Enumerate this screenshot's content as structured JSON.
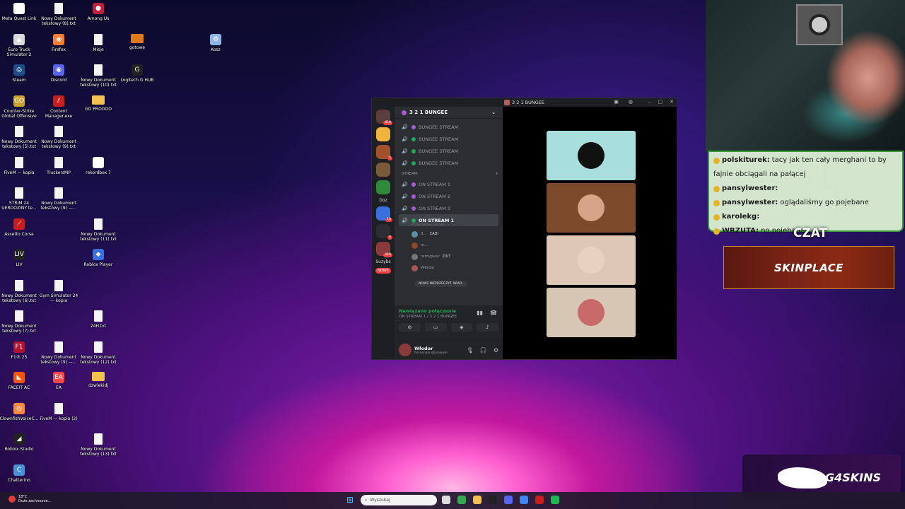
{
  "desktop": {
    "icons": [
      {
        "label": "Meta Quest Link",
        "color": "#ffffff",
        "glyph": "∞",
        "kind": "app"
      },
      {
        "label": "Nowy Dokument tekstowy (8).txt",
        "color": "#ffffff",
        "glyph": "",
        "kind": "file"
      },
      {
        "label": "Among Us",
        "color": "#c0203a",
        "glyph": "●",
        "kind": "app"
      },
      {
        "label": "Euro Truck Simulator 2",
        "color": "#d9d9d9",
        "glyph": "▲",
        "kind": "app"
      },
      {
        "label": "Firefox",
        "color": "#ff7b2e",
        "glyph": "◉",
        "kind": "app"
      },
      {
        "label": "Misje",
        "color": "#ffffff",
        "glyph": "",
        "kind": "file"
      },
      {
        "label": "gotowe",
        "color": "#e07a1a",
        "glyph": "",
        "kind": "folder"
      },
      {
        "label": "Kosz",
        "color": "#8fb7e6",
        "glyph": "♻",
        "kind": "app"
      },
      {
        "label": "Steam",
        "color": "#1b4f8a",
        "glyph": "◎",
        "kind": "app"
      },
      {
        "label": "Discord",
        "color": "#5865f2",
        "glyph": "◉",
        "kind": "app"
      },
      {
        "label": "Nowy Dokument tekstowy (10).txt",
        "color": "#ffffff",
        "glyph": "",
        "kind": "file"
      },
      {
        "label": "Logitech G HUB",
        "color": "#222222",
        "glyph": "G",
        "kind": "app"
      },
      {
        "label": "Counter-Strike Global Offensive",
        "color": "#c9a227",
        "glyph": "GO",
        "kind": "app"
      },
      {
        "label": "Content Manager.exe",
        "color": "#c81e1e",
        "glyph": "⫽",
        "kind": "app"
      },
      {
        "label": "GO PROOOO",
        "color": "#f2c14e",
        "glyph": "",
        "kind": "folder"
      },
      {
        "label": "Nowy Dokument tekstowy (5).txt",
        "color": "#ffffff",
        "glyph": "",
        "kind": "file"
      },
      {
        "label": "Nowy Dokument tekstowy (9).txt",
        "color": "#ffffff",
        "glyph": "",
        "kind": "file"
      },
      {
        "label": "FiveM — kopia",
        "color": "#ffffff",
        "glyph": "",
        "kind": "file"
      },
      {
        "label": "TruckersMP",
        "color": "#ffffff",
        "glyph": "",
        "kind": "file"
      },
      {
        "label": "rekordbox 7",
        "color": "#ffffff",
        "glyph": "◎",
        "kind": "app"
      },
      {
        "label": "STRIM 24 UERDOZINY te...",
        "color": "#ffffff",
        "glyph": "",
        "kind": "file"
      },
      {
        "label": "Nowy Dokument tekstowy (9) —...",
        "color": "#ffffff",
        "glyph": "",
        "kind": "file"
      },
      {
        "label": "Assetto Corsa",
        "color": "#c81e1e",
        "glyph": "⟋",
        "kind": "app"
      },
      {
        "label": "Nowy Dokument tekstowy (11).txt",
        "color": "#ffffff",
        "glyph": "",
        "kind": "file"
      },
      {
        "label": "LIV",
        "color": "#222222",
        "glyph": "LIV",
        "kind": "app"
      },
      {
        "label": "Roblox Player",
        "color": "#3a6fe0",
        "glyph": "◆",
        "kind": "app"
      },
      {
        "label": "Nowy Dokument tekstowy (6).txt",
        "color": "#ffffff",
        "glyph": "",
        "kind": "file"
      },
      {
        "label": "Gym Simulator 24 — kopia",
        "color": "#ffffff",
        "glyph": "",
        "kind": "file"
      },
      {
        "label": "Nowy Dokument tekstowy (7).txt",
        "color": "#ffffff",
        "glyph": "",
        "kind": "file"
      },
      {
        "label": "24H.txt",
        "color": "#ffffff",
        "glyph": "",
        "kind": "file"
      },
      {
        "label": "F1® 25",
        "color": "#b0122e",
        "glyph": "F1",
        "kind": "app"
      },
      {
        "label": "Nowy Dokument tekstowy (9) —...",
        "color": "#ffffff",
        "glyph": "",
        "kind": "file"
      },
      {
        "label": "Nowy Dokument tekstowy (12).txt",
        "color": "#ffffff",
        "glyph": "",
        "kind": "file"
      },
      {
        "label": "FACEIT AC",
        "color": "#ff5500",
        "glyph": "◣",
        "kind": "app"
      },
      {
        "label": "EA",
        "color": "#ff4747",
        "glyph": "EA",
        "kind": "app"
      },
      {
        "label": "dzwiekidj",
        "color": "#f2c14e",
        "glyph": "",
        "kind": "folder"
      },
      {
        "label": "ClownfishVoiceC...",
        "color": "#ff8a3d",
        "glyph": "◎",
        "kind": "app"
      },
      {
        "label": "FiveM — kopia (2)",
        "color": "#ffffff",
        "glyph": "",
        "kind": "file"
      },
      {
        "label": "Roblox Studio",
        "color": "#222222",
        "glyph": "◢",
        "kind": "app"
      },
      {
        "label": "Nowy Dokument tekstowy (13).txt",
        "color": "#ffffff",
        "glyph": "",
        "kind": "file"
      },
      {
        "label": "Chatterino",
        "color": "#4a90d9",
        "glyph": "C",
        "kind": "app"
      }
    ]
  },
  "discord": {
    "window_title": "3 2 1 BUNGEE",
    "guild_name": "3 2 1 BUNGEE",
    "servers": [
      {
        "kind": "icon",
        "color": "#5c3d3d",
        "badge": "618"
      },
      {
        "kind": "icon",
        "color": "#f0b43c",
        "badge": ""
      },
      {
        "kind": "icon",
        "color": "#a0522d",
        "badge": "5"
      },
      {
        "kind": "icon",
        "color": "#7a5a3a",
        "badge": ""
      },
      {
        "kind": "icon",
        "color": "#2f8a3a",
        "badge": ""
      },
      {
        "kind": "text",
        "text": "Doz"
      },
      {
        "kind": "icon",
        "color": "#3a6fe0",
        "badge": "16"
      },
      {
        "kind": "icon",
        "color": "#2b2d31",
        "badge": "4"
      },
      {
        "kind": "icon",
        "color": "#8a3a3a",
        "badge": "419"
      },
      {
        "kind": "text",
        "text": "Suzybs"
      },
      {
        "kind": "new",
        "text": "NOWE"
      }
    ],
    "voice_channels": [
      {
        "name": "BUNGEE STREAM",
        "dot": "#a35dd6",
        "active": false
      },
      {
        "name": "BUNGEE STREAM",
        "dot": "#23a55a",
        "active": false
      },
      {
        "name": "BUNGEE STREAM",
        "dot": "#23a55a",
        "active": false
      },
      {
        "name": "BUNGEE STREAM",
        "dot": "#23a55a",
        "active": false
      }
    ],
    "category": "STREAM",
    "stream_channels": [
      {
        "name": "ON STREAM 1",
        "dot": "#a35dd6",
        "active": false
      },
      {
        "name": "ON STREAM 2",
        "dot": "#a35dd6",
        "active": false
      },
      {
        "name": "ON STREAM 3",
        "dot": "#a35dd6",
        "active": false
      },
      {
        "name": "ON STREAM 1",
        "dot": "#23a55a",
        "active": true
      }
    ],
    "channel_status_hint": "Ustaw status kanału",
    "members": [
      {
        "name": "3...",
        "extra": "CADI",
        "color": "#5b8fa8"
      },
      {
        "name": "m...",
        "extra": "",
        "color": "#8a4a2a"
      },
      {
        "name": "remigiusz",
        "extra": "ZIUT",
        "color": "#777777"
      },
      {
        "name": "Włodar",
        "extra": "",
        "color": "#aa5555"
      }
    ],
    "unread_pill": "NOWE NIEPRZECZYT. WIAD.",
    "voice_status": "Nawiązano połączenie",
    "voice_channel_path": "ON STREAM 1 / 3 2 1 BUNGEE",
    "user_name": "Włodar",
    "user_status": "Na kanale głosowym",
    "tiles": [
      {
        "bg": "#a9dede",
        "face": "#111111"
      },
      {
        "bg": "#7a4a2a",
        "face": "#d8a488"
      },
      {
        "bg": "#dcc8b4",
        "face": "#e6d2be"
      },
      {
        "bg": "#d8c6b4",
        "face": "#c86a6a"
      }
    ]
  },
  "stream": {
    "chat_title": "CZAT",
    "chat_lines": [
      {
        "user": "polskiturek",
        "text": "tacy jak ten cały merghani to by"
      },
      {
        "user": "",
        "text": "fajnie obciągali na pałącej"
      },
      {
        "user": "pansylwester",
        "text": ""
      },
      {
        "user": "pansylwester",
        "text": "oglądaliśmy go pojebane"
      },
      {
        "user": "karolekg",
        "text": ""
      },
      {
        "user": "WRZUTA",
        "text": "no pojebane"
      }
    ],
    "banner_text": "SKINPLACE",
    "sponsor_text": "G4SKINS"
  },
  "taskbar": {
    "weather_temp": "18°C",
    "weather_desc": "Duże zachmurze...",
    "search_placeholder": "Wyszukaj",
    "apps": [
      {
        "name": "task-view-icon",
        "color": "#dddddd"
      },
      {
        "name": "chrome-icon",
        "color": "#34a853"
      },
      {
        "name": "file-explorer-icon",
        "color": "#f2c14e"
      },
      {
        "name": "app-icon",
        "color": "#222222"
      },
      {
        "name": "discord-icon",
        "color": "#5865f2"
      },
      {
        "name": "chrome-profile-icon",
        "color": "#4285f4"
      },
      {
        "name": "app-icon-2",
        "color": "#c81e1e"
      },
      {
        "name": "spotify-icon",
        "color": "#1db954"
      }
    ]
  }
}
